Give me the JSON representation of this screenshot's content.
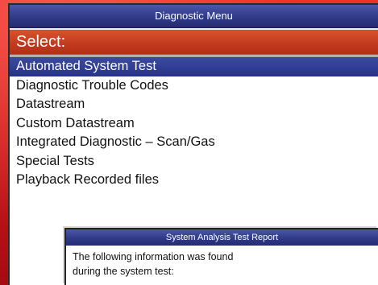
{
  "window": {
    "title": "Diagnostic Menu",
    "select_label": "Select:"
  },
  "menu": {
    "items": [
      {
        "label": "Automated System Test",
        "selected": true
      },
      {
        "label": "Diagnostic Trouble Codes",
        "selected": false
      },
      {
        "label": "Datastream",
        "selected": false
      },
      {
        "label": "Custom Datastream",
        "selected": false
      },
      {
        "label": "Integrated Diagnostic – Scan/Gas",
        "selected": false
      },
      {
        "label": "Special Tests",
        "selected": false
      },
      {
        "label": "Playback Recorded files",
        "selected": false
      }
    ]
  },
  "report": {
    "title": "System Analysis Test Report",
    "line1": "The following information was found",
    "line2": "during the system test:"
  },
  "colors": {
    "background": "#d11a1a",
    "title_bar": "#2f3a88",
    "select_bar": "#c23a1e",
    "selected_item": "#27338a"
  }
}
